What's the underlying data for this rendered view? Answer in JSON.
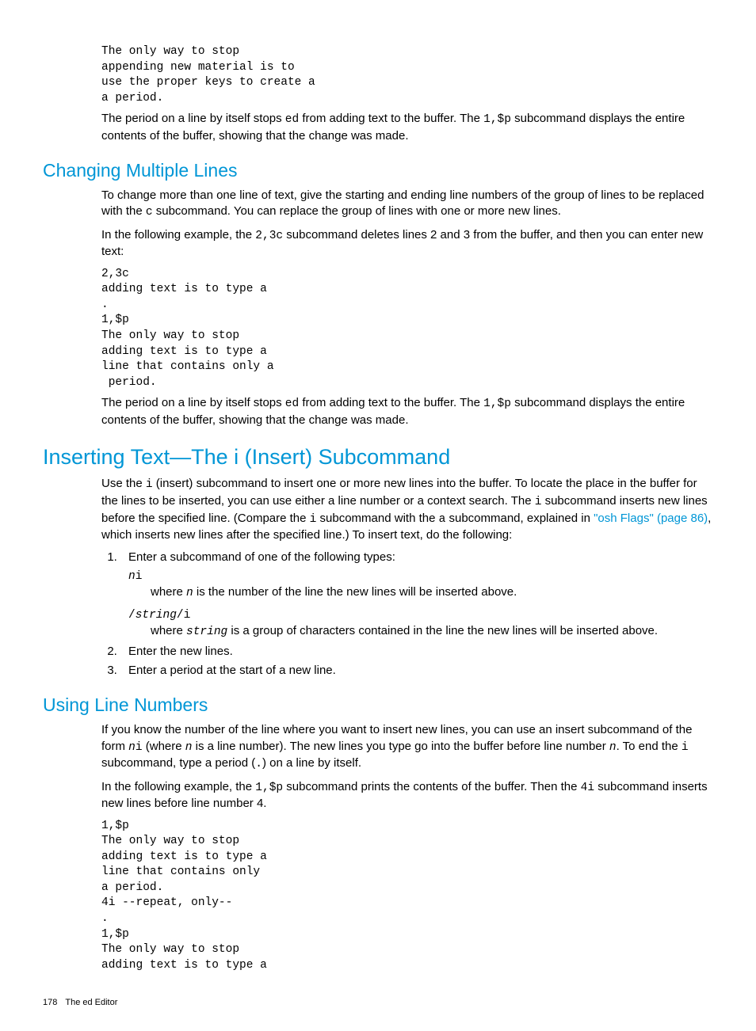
{
  "code1": "The only way to stop\nappending new material is to\nuse the proper keys to create a\na period.",
  "para1_a": "The period on a line by itself stops ",
  "para1_b": " from adding text to the buffer. The ",
  "para1_c": " subcommand displays the entire contents of the buffer, showing that the change was made.",
  "mono_ed": "ed",
  "mono_1sp": "1,$p",
  "h_changing": "Changing Multiple Lines",
  "para2_a": "To change more than one line of text, give the starting and ending line numbers of the group of lines to be replaced with the ",
  "para2_b": " subcommand. You can replace the group of lines with one or more new lines.",
  "mono_c": "c",
  "para3_a": "In the following example, the ",
  "para3_b": " subcommand deletes lines 2 and 3 from the buffer, and then you can enter new text:",
  "mono_23c": "2,3c",
  "code2": "2,3c\nadding text is to type a\n.\n1,$p\nThe only way to stop\nadding text is to type a\nline that contains only a\n period.",
  "h_inserting": "Inserting Text—The i (Insert) Subcommand",
  "para4_a": "Use the ",
  "para4_b": " (insert) subcommand to insert one or more new lines into the buffer. To locate the place in the buffer for the lines to be inserted, you can use either a line number or a context search. The ",
  "para4_c": " subcommand inserts new lines before the specified line. (Compare the ",
  "para4_d": " subcommand with the ",
  "para4_e": " subcommand, explained in ",
  "para4_f": ", which inserts new lines after the specified line.) To insert text, do the following:",
  "mono_i": "i",
  "mono_a": "a",
  "link_text": "\"osh Flags\" (page 86)",
  "step1": "Enter a subcommand of one of the following types:",
  "form1_a": "n",
  "form1_b": "i",
  "form1_desc_a": "where ",
  "form1_desc_b": " is the number of the line the new lines will be inserted above.",
  "mono_n": "n",
  "form2_a": "/",
  "form2_b": "string",
  "form2_c": "/i",
  "form2_desc_a": "where ",
  "form2_desc_b": " is a group of characters contained in the line the new lines will be inserted above.",
  "mono_string": "string",
  "step2": "Enter the new lines.",
  "step3": "Enter a period at the start of a new line.",
  "h_using": "Using Line Numbers",
  "para5_a": "If you know the number of the line where you want to insert new lines, you can use an insert subcommand of the form ",
  "para5_b": " (where ",
  "para5_c": " is a line number). The new lines you type go into the buffer before line number ",
  "para5_d": ". To end the ",
  "para5_e": " subcommand, type a period (",
  "para5_f": ") on a line by itself.",
  "mono_ni_n": "n",
  "mono_ni_i": "i",
  "mono_dot": ".",
  "para6_a": "In the following example, the ",
  "para6_b": " subcommand prints the contents of the buffer. Then the ",
  "para6_c": " subcommand inserts new lines before line number 4.",
  "mono_4i": "4i",
  "code3": "1,$p\nThe only way to stop\nadding text is to type a\nline that contains only\na period.\n4i --repeat, only--\n.\n1,$p\nThe only way to stop\nadding text is to type a",
  "footer_page": "178",
  "footer_title": "The ed Editor"
}
